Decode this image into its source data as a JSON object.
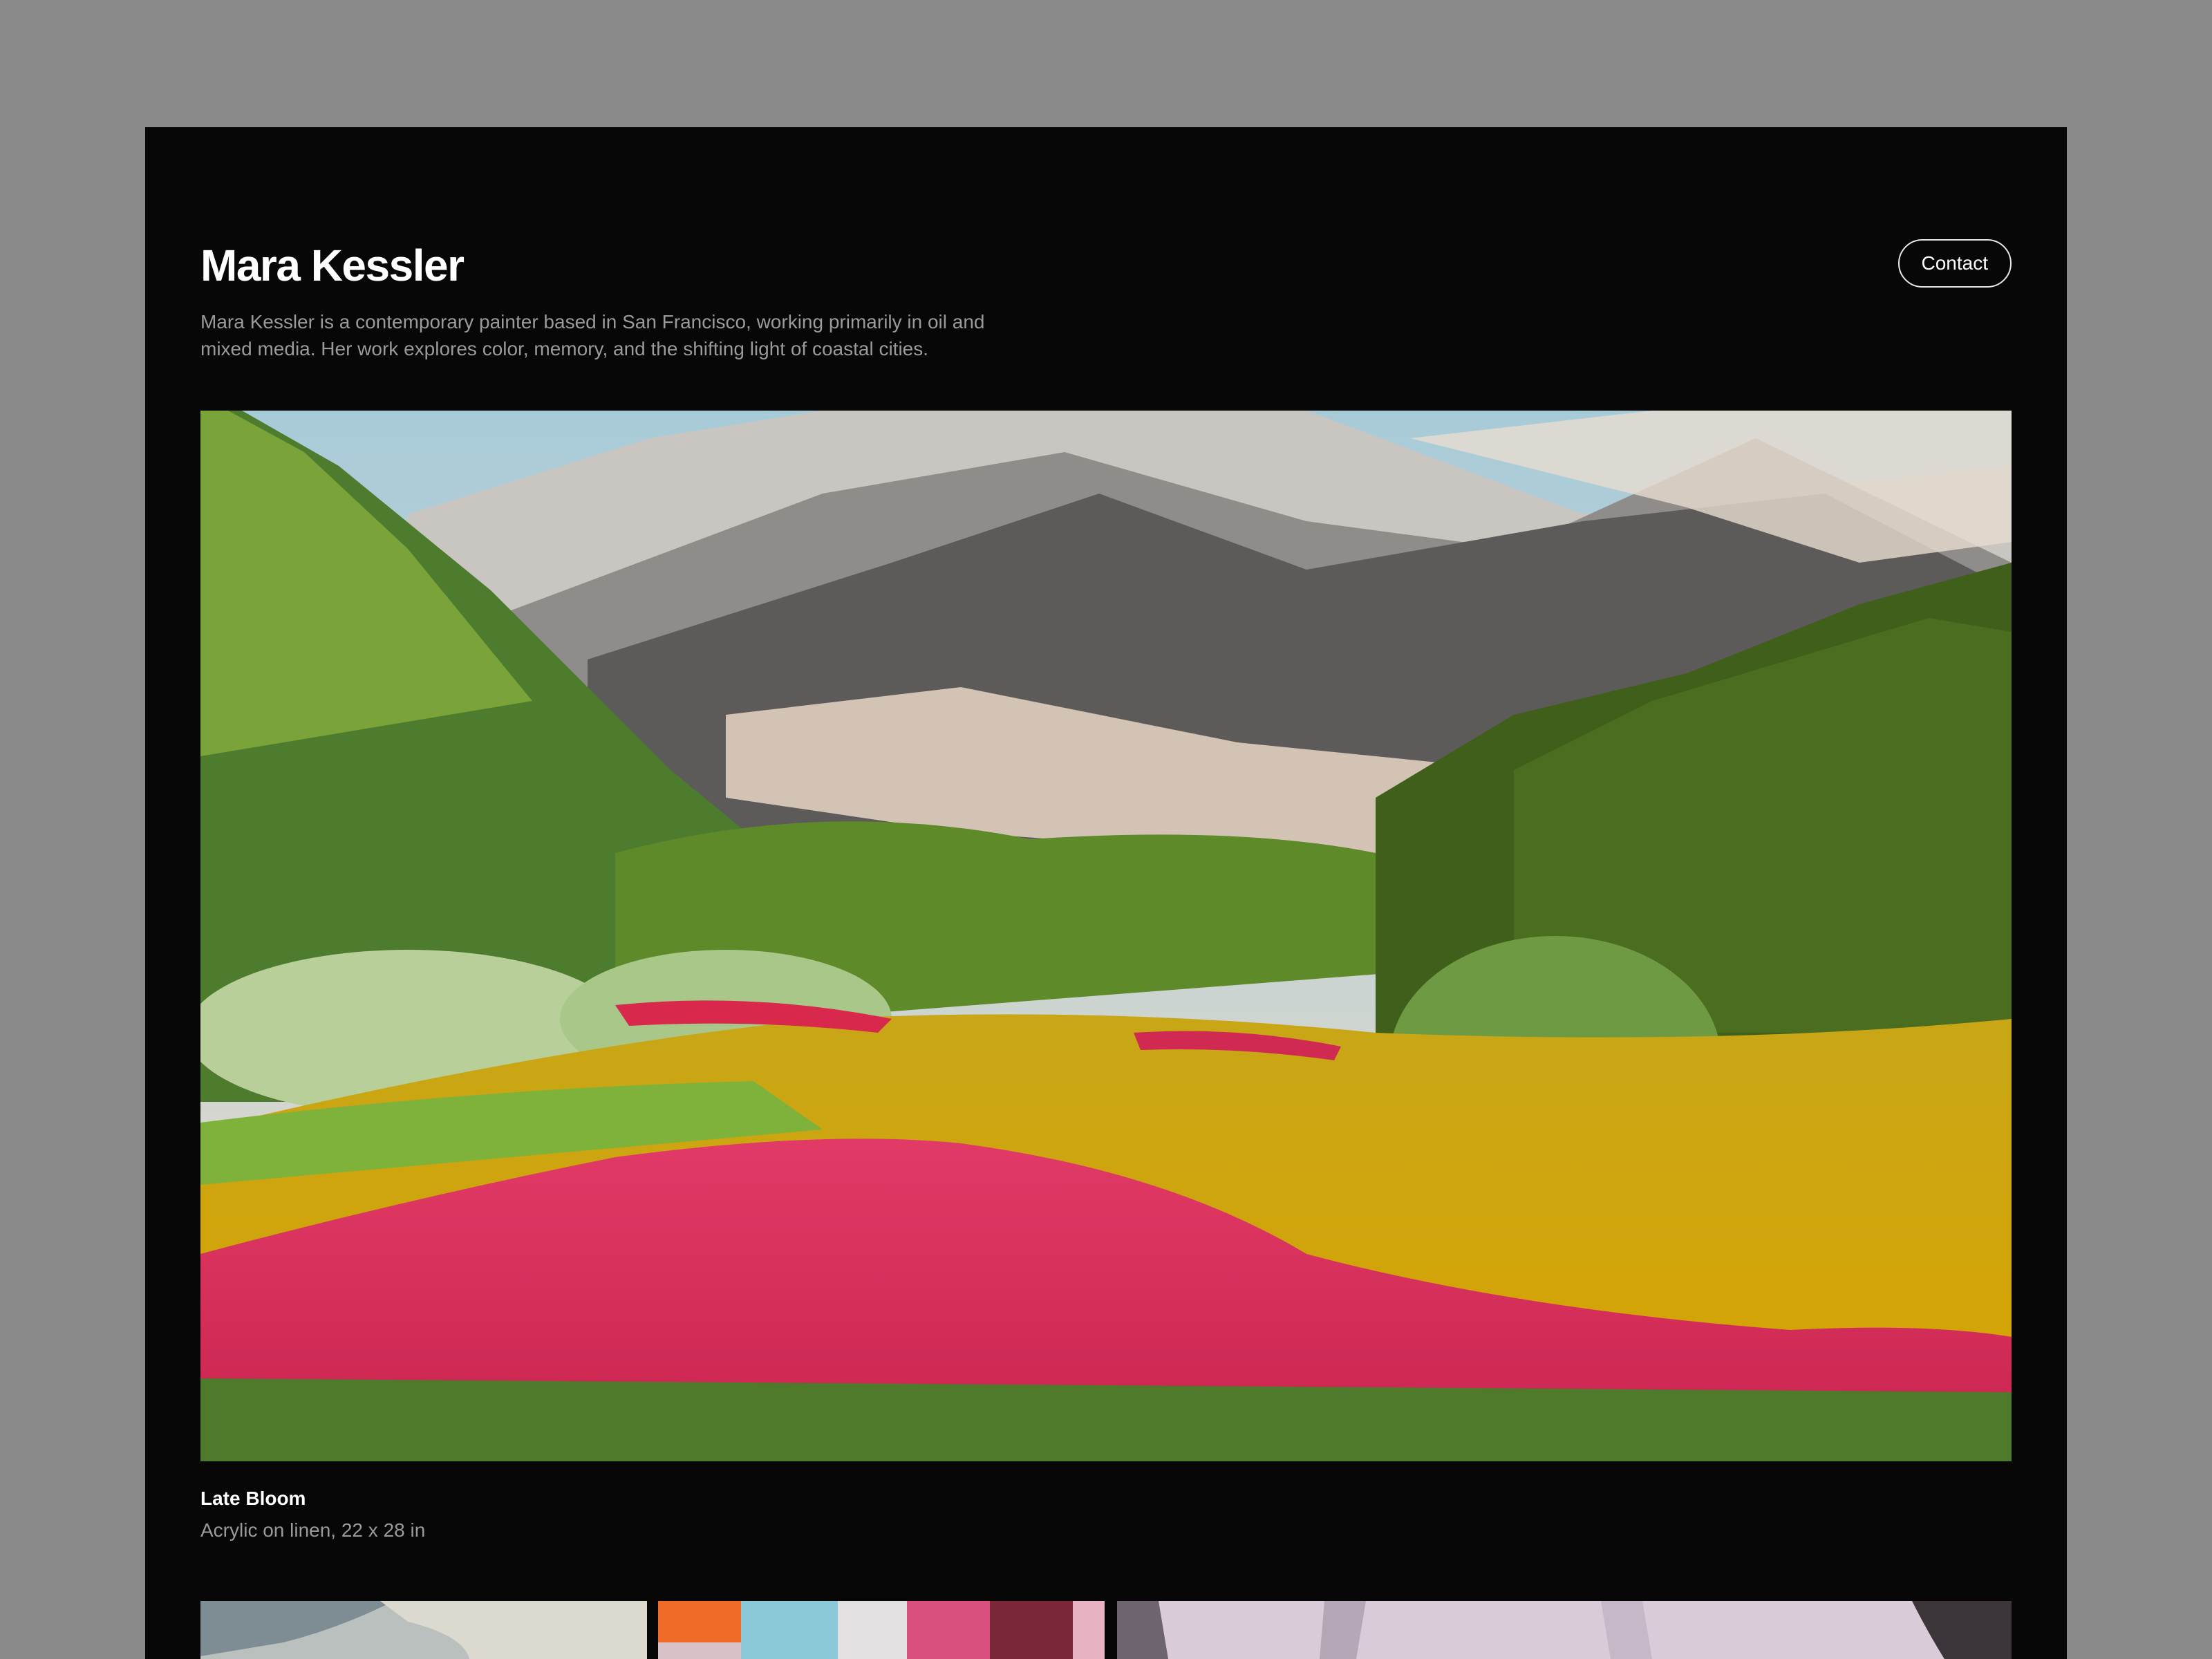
{
  "header": {
    "artist_name": "Mara Kessler",
    "bio": "Mara Kessler is a contemporary painter based in San Francisco, working primarily in oil and mixed media. Her work explores color, memory, and the shifting light of coastal cities.",
    "contact_label": "Contact"
  },
  "featured": {
    "title": "Late Bloom",
    "meta": "Acrylic on linen, 22 x 28 in"
  }
}
